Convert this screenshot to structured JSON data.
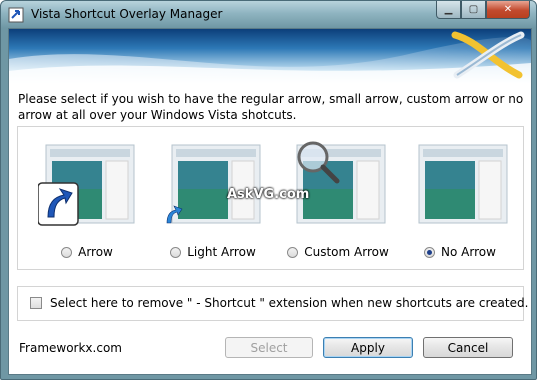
{
  "window": {
    "title": "Vista Shortcut Overlay Manager"
  },
  "caption_buttons": {
    "minimize_icon": "minimize-icon",
    "maximize_icon": "maximize-icon",
    "close_icon": "close-icon"
  },
  "intro_text": "Please select if you wish to have the regular arrow, small arrow, custom arrow or no arrow at all over your Windows Vista shotcuts.",
  "options": [
    {
      "label": "Arrow",
      "selected": false,
      "icon": "large-arrow-overlay-preview"
    },
    {
      "label": "Light Arrow",
      "selected": false,
      "icon": "small-arrow-overlay-preview"
    },
    {
      "label": "Custom Arrow",
      "selected": false,
      "icon": "magnifier-overlay-preview"
    },
    {
      "label": "No Arrow",
      "selected": true,
      "icon": "no-arrow-overlay-preview"
    }
  ],
  "watermark": "AskVG.com",
  "checkbox": {
    "label": "Select here to remove \" - Shortcut \" extension when new shortcuts are created.",
    "checked": false
  },
  "footer": {
    "brand": "Frameworkx.com"
  },
  "buttons": {
    "select": "Select",
    "apply": "Apply",
    "cancel": "Cancel"
  },
  "colors": {
    "accent": "#1d3f8a",
    "banner_top": "#2d6ea6",
    "banner_bottom": "#ffffff"
  }
}
